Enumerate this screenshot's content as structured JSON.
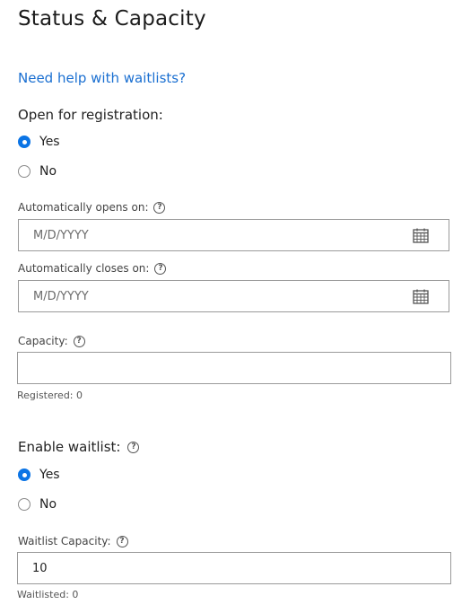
{
  "section": {
    "title": "Status & Capacity"
  },
  "help_link": "Need help with waitlists?",
  "registration": {
    "label": "Open for registration:",
    "options": [
      {
        "label": "Yes",
        "selected": true
      },
      {
        "label": "No",
        "selected": false
      }
    ]
  },
  "opens": {
    "label": "Automatically opens on:",
    "placeholder": "M/D/YYYY",
    "value": "",
    "icon": "calendar-icon"
  },
  "closes": {
    "label": "Automatically closes on:",
    "placeholder": "M/D/YYYY",
    "value": "",
    "icon": "calendar-icon"
  },
  "capacity": {
    "label": "Capacity:",
    "value": "",
    "registered": "Registered: 0"
  },
  "waitlist": {
    "label": "Enable waitlist:",
    "options": [
      {
        "label": "Yes",
        "selected": true
      },
      {
        "label": "No",
        "selected": false
      }
    ],
    "capacity_label": "Waitlist Capacity:",
    "capacity_value": "10",
    "waitlisted": "Waitlisted: 0"
  },
  "help_glyph": "?",
  "colors": {
    "accent": "#0b74e5",
    "link": "#1a6fd1",
    "border": "#9a9a9a"
  }
}
